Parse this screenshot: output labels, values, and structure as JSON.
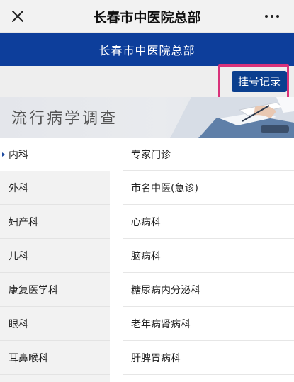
{
  "topbar": {
    "title": "长春市中医院总部",
    "close_icon": "close-icon",
    "more_icon": "more-dots-icon"
  },
  "header": {
    "title": "长春市中医院总部",
    "color": "#0d3e9b"
  },
  "actions": {
    "registration_record": "挂号记录",
    "highlight_color": "#d9327a"
  },
  "banner": {
    "title": "流行病学调查"
  },
  "departments": [
    {
      "label": "内科",
      "active": true
    },
    {
      "label": "外科"
    },
    {
      "label": "妇产科"
    },
    {
      "label": "儿科"
    },
    {
      "label": "康复医学科"
    },
    {
      "label": "眼科"
    },
    {
      "label": "耳鼻喉科"
    }
  ],
  "clinics": [
    {
      "label": "专家门诊"
    },
    {
      "label": "市名中医(急诊)"
    },
    {
      "label": "心病科"
    },
    {
      "label": "脑病科"
    },
    {
      "label": "糖尿病内分泌科"
    },
    {
      "label": "老年病肾病科"
    },
    {
      "label": "肝脾胃病科"
    }
  ]
}
